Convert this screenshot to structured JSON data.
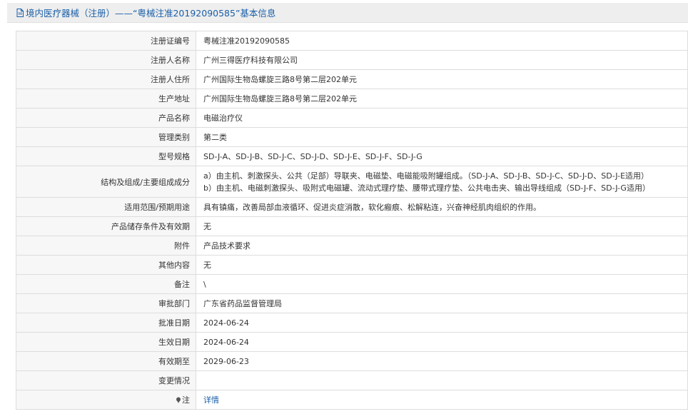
{
  "header": {
    "title": "境内医疗器械（注册）——“粤械注准20192090585”基本信息",
    "icon": "document-icon",
    "color": "#1a5fa8"
  },
  "rows": {
    "reg_no": {
      "label": "注册证编号",
      "value": "粤械注准20192090585"
    },
    "registrant": {
      "label": "注册人名称",
      "value": "广州三得医疗科技有限公司"
    },
    "registrant_address": {
      "label": "注册人住所",
      "value": "广州国际生物岛螺旋三路8号第二层202单元"
    },
    "production_address": {
      "label": "生产地址",
      "value": "广州国际生物岛螺旋三路8号第二层202单元"
    },
    "product_name": {
      "label": "产品名称",
      "value": "电磁治疗仪"
    },
    "category": {
      "label": "管理类别",
      "value": "第二类"
    },
    "models": {
      "label": "型号规格",
      "value": "SD-J-A、SD-J-B、SD-J-C、SD-J-D、SD-J-E、SD-J-F、SD-J-G"
    },
    "structure": {
      "label": "结构及组成/主要组成成分",
      "line1": "a）由主机、刺激探头、公共（足部）导联夹、电磁垫、电磁能吸附罐组成。（SD-J-A、SD-J-B、SD-J-C、SD-J-D、SD-J-E适用）",
      "line2": "b）由主机、电磁刺激探头、吸附式电磁罐、流动式理疗垫、腰带式理疗垫、公共电击夹、输出导线组成（SD-J-F、SD-J-G适用）"
    },
    "scope": {
      "label": "适用范围/预期用途",
      "value": "具有镇痛，改善局部血液循环、促进炎症消散，软化瘢痕、松解粘连，兴奋神经肌肉组织的作用。"
    },
    "storage": {
      "label": "产品储存条件及有效期",
      "value": "无"
    },
    "attachment": {
      "label": "附件",
      "value": "产品技术要求"
    },
    "other": {
      "label": "其他内容",
      "value": "无"
    },
    "remark": {
      "label": "备注",
      "value": "\\"
    },
    "approval_dept": {
      "label": "审批部门",
      "value": "广东省药品监督管理局"
    },
    "approval_date": {
      "label": "批准日期",
      "value": "2024-06-24"
    },
    "effective_date": {
      "label": "生效日期",
      "value": "2024-06-24"
    },
    "expiry_date": {
      "label": "有效期至",
      "value": "2029-06-23"
    },
    "changes": {
      "label": "变更情况",
      "value": ""
    },
    "note": {
      "label": "注",
      "icon": "pin-icon",
      "link_text": "详情"
    }
  }
}
